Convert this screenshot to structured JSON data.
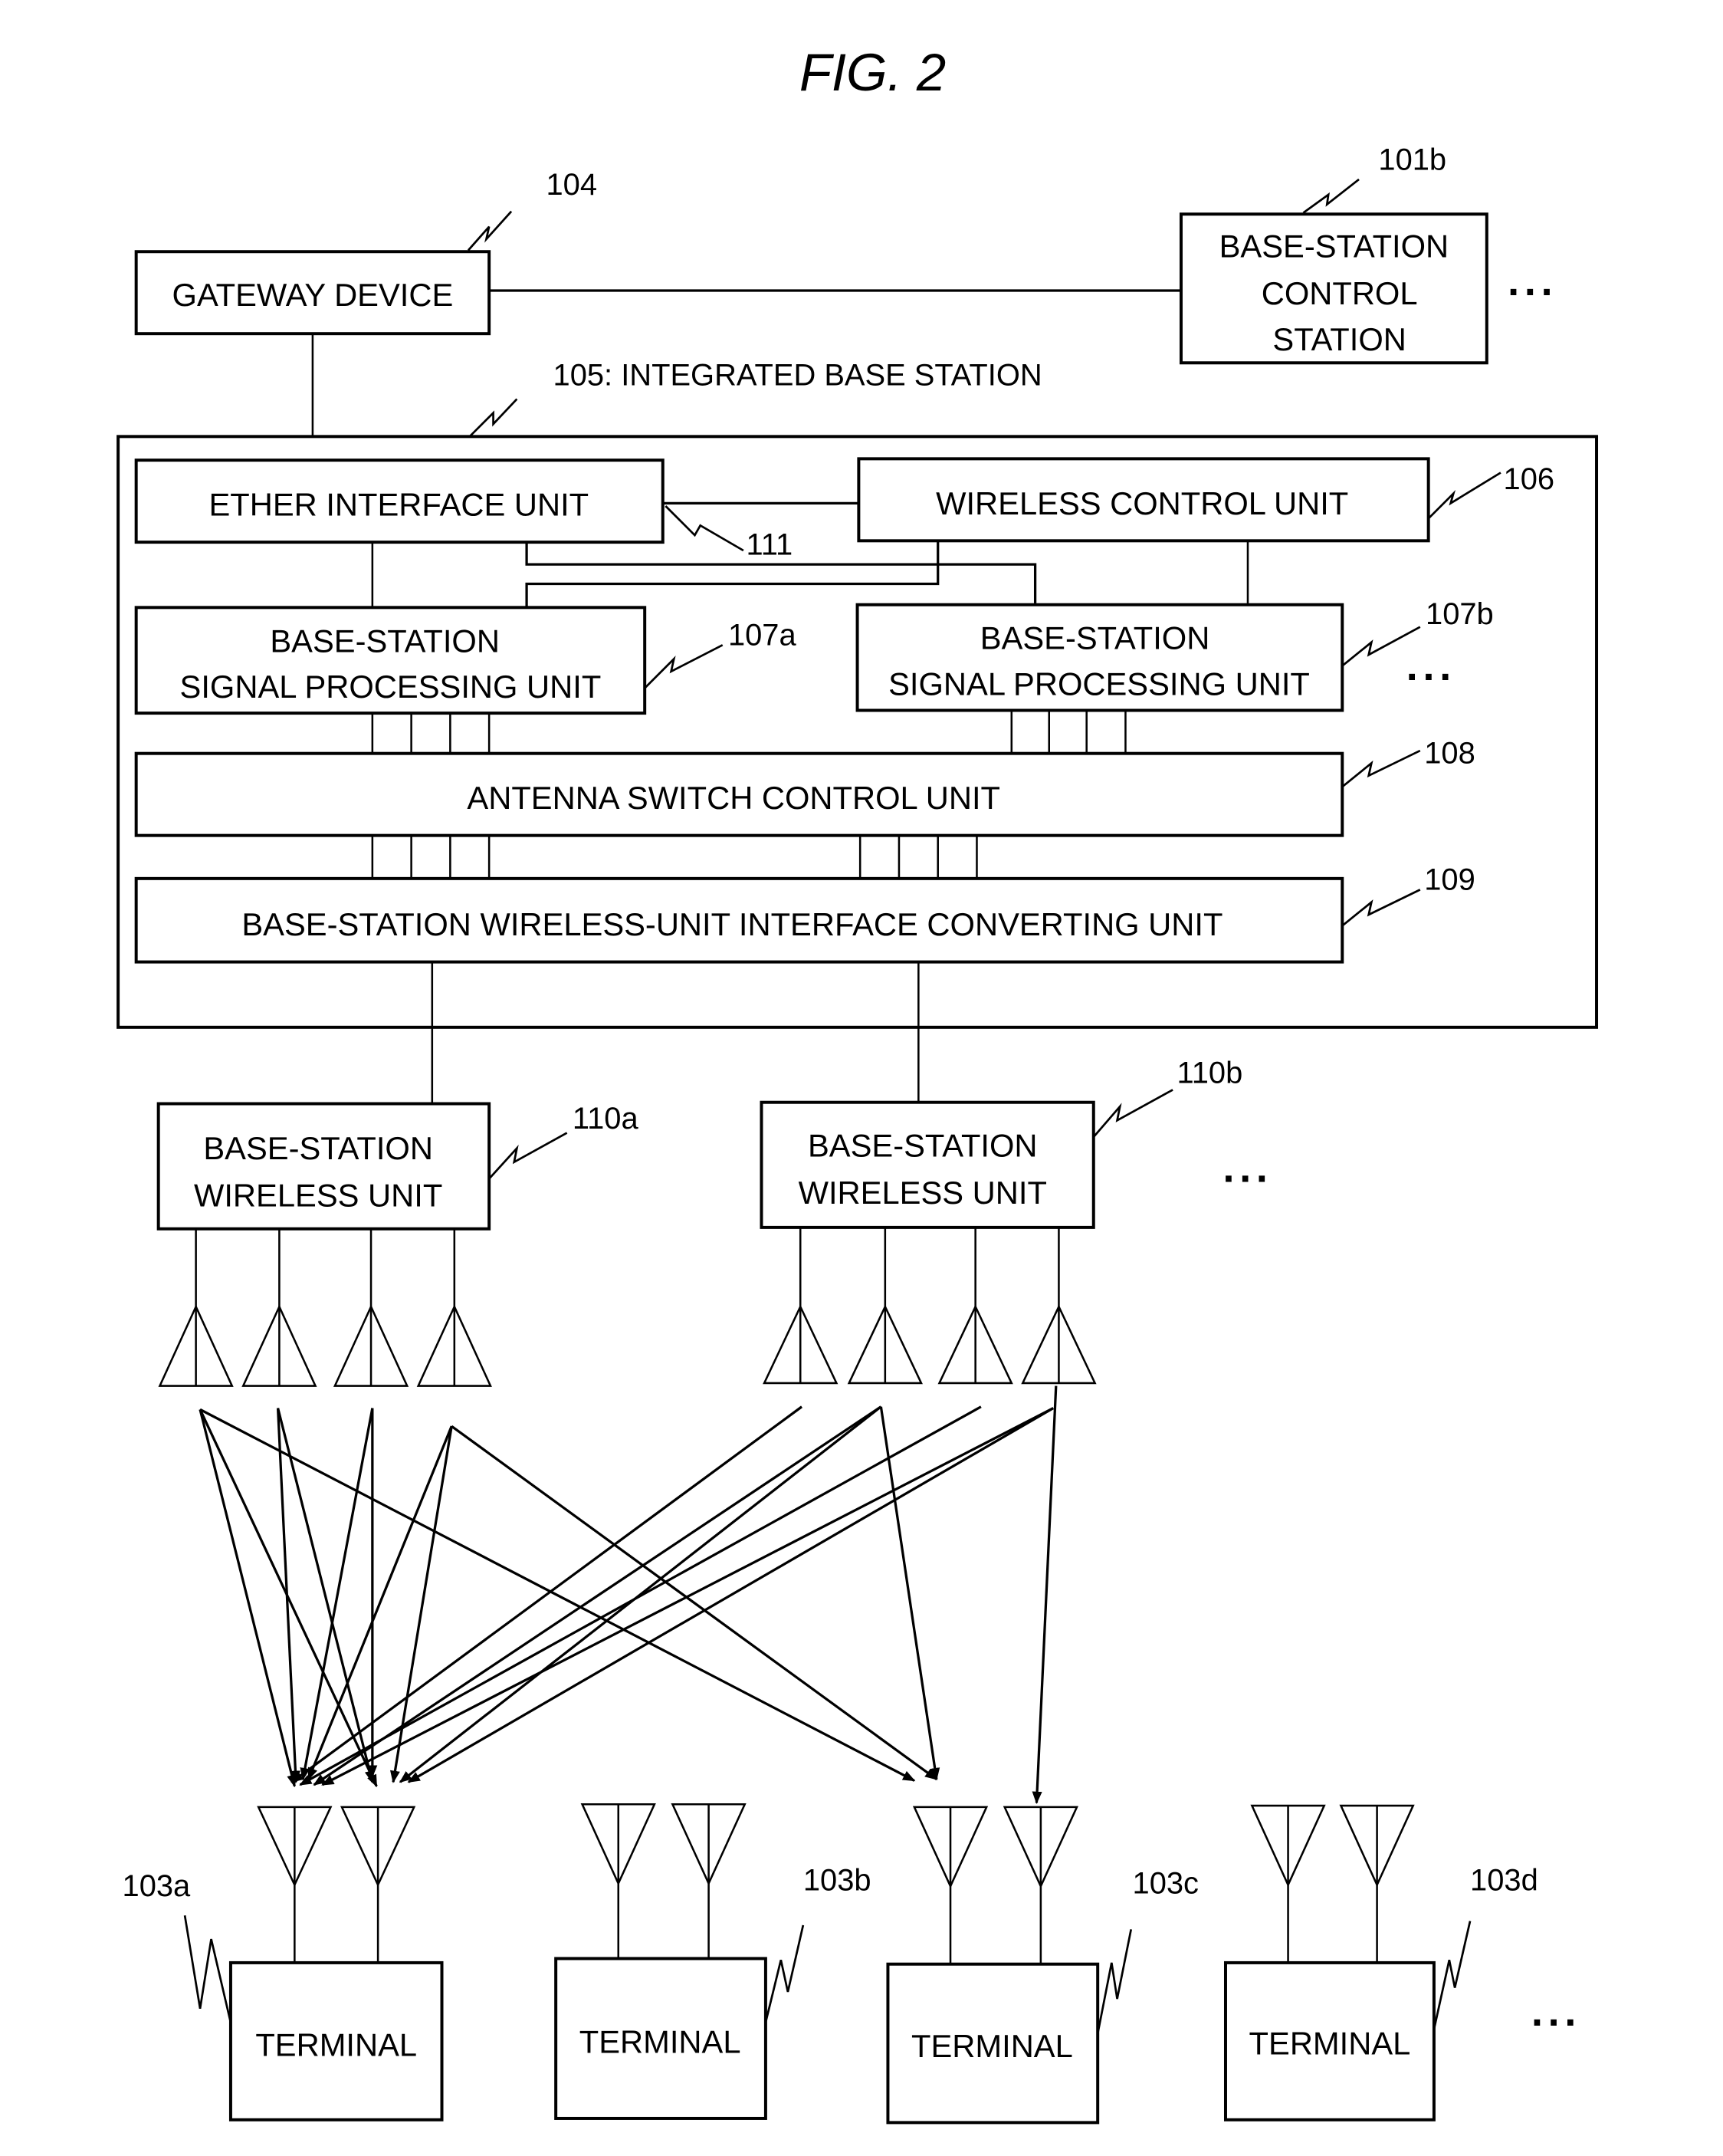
{
  "figure": {
    "title": "FIG.  2"
  },
  "gateway": {
    "label": "GATEWAY DEVICE",
    "ref": "104"
  },
  "control_station": {
    "lines": [
      "BASE-STATION",
      "CONTROL",
      "STATION"
    ],
    "ref": "101b",
    "more": "···"
  },
  "integrated_base_station": {
    "label": "105: INTEGRATED BASE STATION"
  },
  "ether_interface": {
    "label": "ETHER INTERFACE UNIT"
  },
  "link_ref": "111",
  "wireless_control": {
    "label": "WIRELESS CONTROL UNIT",
    "ref": "106"
  },
  "signal_units": [
    {
      "lines": [
        "BASE-STATION",
        "SIGNAL PROCESSING UNIT"
      ],
      "ref": "107a"
    },
    {
      "lines": [
        "BASE-STATION",
        "SIGNAL PROCESSING UNIT"
      ],
      "ref": "107b"
    }
  ],
  "signal_units_more": "···",
  "antenna_switch": {
    "label": "ANTENNA SWITCH CONTROL UNIT",
    "ref": "108"
  },
  "interface_converter": {
    "label": "BASE-STATION WIRELESS-UNIT INTERFACE CONVERTING UNIT",
    "ref": "109"
  },
  "wireless_units": [
    {
      "lines": [
        "BASE-STATION",
        "WIRELESS UNIT"
      ],
      "ref": "110a"
    },
    {
      "lines": [
        "BASE-STATION",
        "WIRELESS UNIT"
      ],
      "ref": "110b"
    }
  ],
  "wireless_units_more": "···",
  "terminals": [
    {
      "label": "TERMINAL",
      "ref": "103a"
    },
    {
      "label": "TERMINAL",
      "ref": "103b"
    },
    {
      "label": "TERMINAL",
      "ref": "103c"
    },
    {
      "label": "TERMINAL",
      "ref": "103d"
    }
  ],
  "terminals_more": "···"
}
